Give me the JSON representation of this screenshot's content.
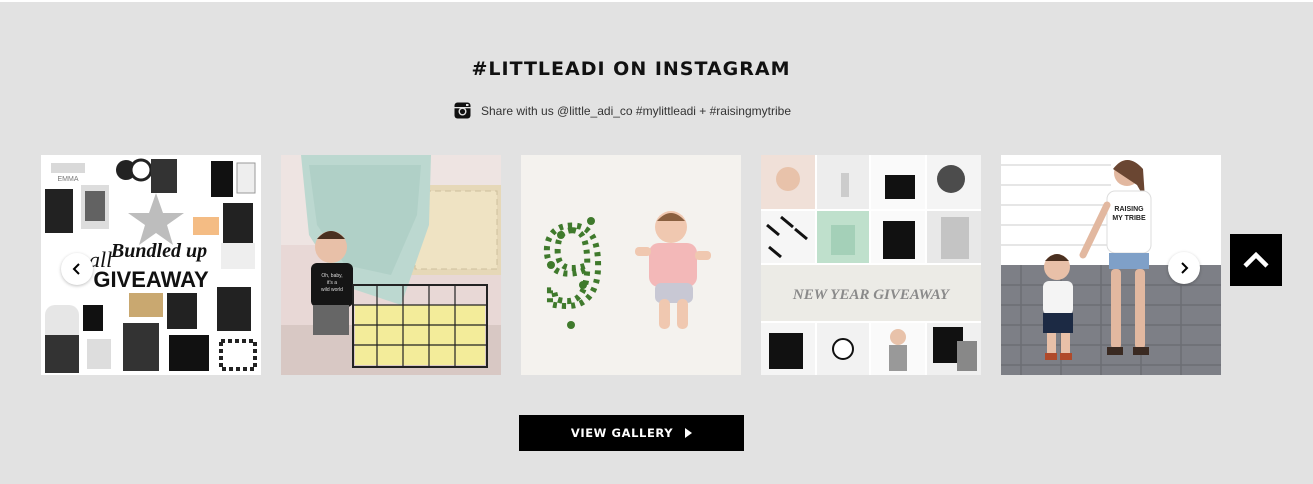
{
  "section": {
    "title": "#LITTLEADI ON INSTAGRAM",
    "share_text": "Share with us @little_adi_co #mylittleadi + #raisingmytribe",
    "share_icon": "instagram-icon"
  },
  "posts": [
    {
      "caption_line1": "all",
      "caption_line2": "Bundled up",
      "caption_line3": "GIVEAWAY",
      "tag": "EMMA"
    },
    {
      "shirt_text_1": "Oh, baby,",
      "shirt_text_2": "it's a",
      "shirt_text_3": "wild world"
    },
    {
      "leaf_number": "9"
    },
    {
      "banner": "NEW YEAR GIVEAWAY"
    },
    {
      "shirt_text_1": "RAISING",
      "shirt_text_2": "MY TRIBE"
    }
  ],
  "carousel": {
    "prev_icon": "chevron-left-icon",
    "next_icon": "chevron-right-icon"
  },
  "back_to_top_icon": "chevron-up-icon",
  "gallery_button": {
    "label": "VIEW GALLERY",
    "icon": "caret-right-icon"
  },
  "colors": {
    "background": "#e2e2e2",
    "button": "#000000",
    "text": "#111111"
  }
}
